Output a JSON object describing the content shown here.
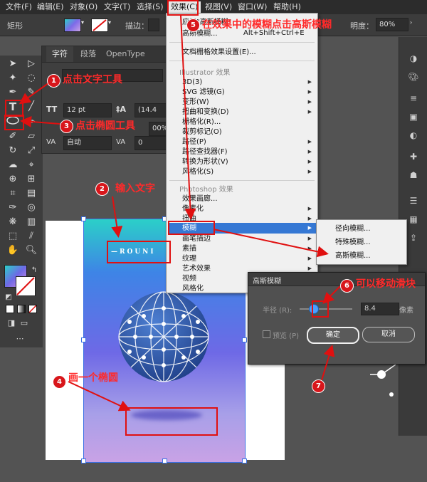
{
  "menubar": {
    "items": [
      "文件(F)",
      "编辑(E)",
      "对象(O)",
      "文字(T)",
      "选择(S)",
      "效果(C)",
      "视图(V)",
      "窗口(W)",
      "帮助(H)"
    ]
  },
  "controlbar": {
    "shape_label": "矩形",
    "stroke_label": "描边：",
    "opacity_label": "明度：",
    "opacity_value": "80%"
  },
  "char_panel": {
    "tabs": [
      "字符",
      "段落",
      "OpenType"
    ],
    "size_value": "12 pt",
    "leading_value": "(14.4",
    "kerning_value": "自动",
    "tracking_value": "0",
    "scale_value": "00%"
  },
  "effect_menu": {
    "top_item_1": "应用\"高斯模糊\"",
    "top_item_1_shortcut": "Alt+Shift+Ctrl+E",
    "top_item_2": "高斯模糊...",
    "top_item_2_shortcut": "Alt+Shift+Ctrl+E",
    "doc_raster_settings": "文档栅格效果设置(E)...",
    "illustrator_section": "Illustrator 效果",
    "illustrator_items": [
      "3D(3)",
      "SVG 滤镜(G)",
      "变形(W)",
      "扭曲和变换(D)",
      "栅格化(R)...",
      "裁剪标记(O)",
      "路径(P)",
      "路径查找器(F)",
      "转换为形状(V)",
      "风格化(S)"
    ],
    "photoshop_section": "Photoshop 效果",
    "photoshop_items": [
      "效果画廊...",
      "像素化",
      "扭曲",
      "模糊",
      "画笔描边",
      "素描",
      "纹理",
      "艺术效果",
      "视频",
      "风格化"
    ]
  },
  "blur_submenu": {
    "items": [
      "径向模糊...",
      "特殊模糊...",
      "高斯模糊..."
    ]
  },
  "dialog": {
    "title": "高斯模糊",
    "radius_label": "半径 (R):",
    "radius_value": "8.4",
    "unit": "像素",
    "preview_label": "预览 (P)",
    "ok_label": "确定",
    "cancel_label": "取消",
    "slider_fraction": 0.25
  },
  "poster": {
    "text": "—ROUNI"
  },
  "annotations": {
    "a1": "点击文字工具",
    "a2": "输入文字",
    "a3": "点击椭圆工具",
    "a4": "画一个椭圆",
    "a5": "在效果中的模糊点击高斯模糊",
    "a6": "可以移动滑块",
    "n1": "1",
    "n2": "2",
    "n3": "3",
    "n4": "4",
    "n5": "5",
    "n6": "6",
    "n7": "7"
  },
  "colors": {
    "accent_red": "#e01010",
    "selection_blue": "#3a6fe3",
    "menu_highlight": "#3578d4"
  }
}
